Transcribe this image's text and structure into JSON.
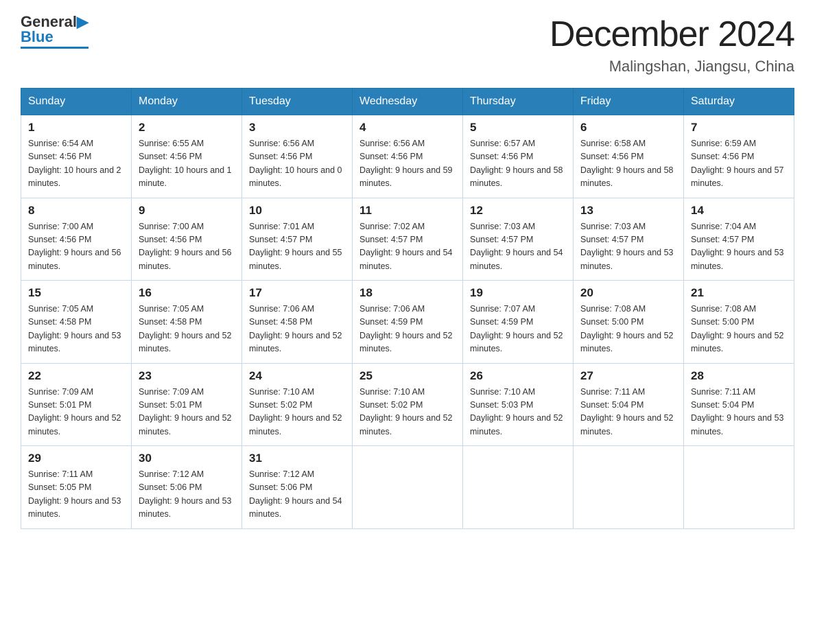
{
  "header": {
    "logo_general": "General",
    "logo_blue": "Blue",
    "title": "December 2024",
    "subtitle": "Malingshan, Jiangsu, China"
  },
  "days_of_week": [
    "Sunday",
    "Monday",
    "Tuesday",
    "Wednesday",
    "Thursday",
    "Friday",
    "Saturday"
  ],
  "weeks": [
    [
      {
        "day": "1",
        "sunrise": "6:54 AM",
        "sunset": "4:56 PM",
        "daylight": "10 hours and 2 minutes."
      },
      {
        "day": "2",
        "sunrise": "6:55 AM",
        "sunset": "4:56 PM",
        "daylight": "10 hours and 1 minute."
      },
      {
        "day": "3",
        "sunrise": "6:56 AM",
        "sunset": "4:56 PM",
        "daylight": "10 hours and 0 minutes."
      },
      {
        "day": "4",
        "sunrise": "6:56 AM",
        "sunset": "4:56 PM",
        "daylight": "9 hours and 59 minutes."
      },
      {
        "day": "5",
        "sunrise": "6:57 AM",
        "sunset": "4:56 PM",
        "daylight": "9 hours and 58 minutes."
      },
      {
        "day": "6",
        "sunrise": "6:58 AM",
        "sunset": "4:56 PM",
        "daylight": "9 hours and 58 minutes."
      },
      {
        "day": "7",
        "sunrise": "6:59 AM",
        "sunset": "4:56 PM",
        "daylight": "9 hours and 57 minutes."
      }
    ],
    [
      {
        "day": "8",
        "sunrise": "7:00 AM",
        "sunset": "4:56 PM",
        "daylight": "9 hours and 56 minutes."
      },
      {
        "day": "9",
        "sunrise": "7:00 AM",
        "sunset": "4:56 PM",
        "daylight": "9 hours and 56 minutes."
      },
      {
        "day": "10",
        "sunrise": "7:01 AM",
        "sunset": "4:57 PM",
        "daylight": "9 hours and 55 minutes."
      },
      {
        "day": "11",
        "sunrise": "7:02 AM",
        "sunset": "4:57 PM",
        "daylight": "9 hours and 54 minutes."
      },
      {
        "day": "12",
        "sunrise": "7:03 AM",
        "sunset": "4:57 PM",
        "daylight": "9 hours and 54 minutes."
      },
      {
        "day": "13",
        "sunrise": "7:03 AM",
        "sunset": "4:57 PM",
        "daylight": "9 hours and 53 minutes."
      },
      {
        "day": "14",
        "sunrise": "7:04 AM",
        "sunset": "4:57 PM",
        "daylight": "9 hours and 53 minutes."
      }
    ],
    [
      {
        "day": "15",
        "sunrise": "7:05 AM",
        "sunset": "4:58 PM",
        "daylight": "9 hours and 53 minutes."
      },
      {
        "day": "16",
        "sunrise": "7:05 AM",
        "sunset": "4:58 PM",
        "daylight": "9 hours and 52 minutes."
      },
      {
        "day": "17",
        "sunrise": "7:06 AM",
        "sunset": "4:58 PM",
        "daylight": "9 hours and 52 minutes."
      },
      {
        "day": "18",
        "sunrise": "7:06 AM",
        "sunset": "4:59 PM",
        "daylight": "9 hours and 52 minutes."
      },
      {
        "day": "19",
        "sunrise": "7:07 AM",
        "sunset": "4:59 PM",
        "daylight": "9 hours and 52 minutes."
      },
      {
        "day": "20",
        "sunrise": "7:08 AM",
        "sunset": "5:00 PM",
        "daylight": "9 hours and 52 minutes."
      },
      {
        "day": "21",
        "sunrise": "7:08 AM",
        "sunset": "5:00 PM",
        "daylight": "9 hours and 52 minutes."
      }
    ],
    [
      {
        "day": "22",
        "sunrise": "7:09 AM",
        "sunset": "5:01 PM",
        "daylight": "9 hours and 52 minutes."
      },
      {
        "day": "23",
        "sunrise": "7:09 AM",
        "sunset": "5:01 PM",
        "daylight": "9 hours and 52 minutes."
      },
      {
        "day": "24",
        "sunrise": "7:10 AM",
        "sunset": "5:02 PM",
        "daylight": "9 hours and 52 minutes."
      },
      {
        "day": "25",
        "sunrise": "7:10 AM",
        "sunset": "5:02 PM",
        "daylight": "9 hours and 52 minutes."
      },
      {
        "day": "26",
        "sunrise": "7:10 AM",
        "sunset": "5:03 PM",
        "daylight": "9 hours and 52 minutes."
      },
      {
        "day": "27",
        "sunrise": "7:11 AM",
        "sunset": "5:04 PM",
        "daylight": "9 hours and 52 minutes."
      },
      {
        "day": "28",
        "sunrise": "7:11 AM",
        "sunset": "5:04 PM",
        "daylight": "9 hours and 53 minutes."
      }
    ],
    [
      {
        "day": "29",
        "sunrise": "7:11 AM",
        "sunset": "5:05 PM",
        "daylight": "9 hours and 53 minutes."
      },
      {
        "day": "30",
        "sunrise": "7:12 AM",
        "sunset": "5:06 PM",
        "daylight": "9 hours and 53 minutes."
      },
      {
        "day": "31",
        "sunrise": "7:12 AM",
        "sunset": "5:06 PM",
        "daylight": "9 hours and 54 minutes."
      },
      null,
      null,
      null,
      null
    ]
  ]
}
